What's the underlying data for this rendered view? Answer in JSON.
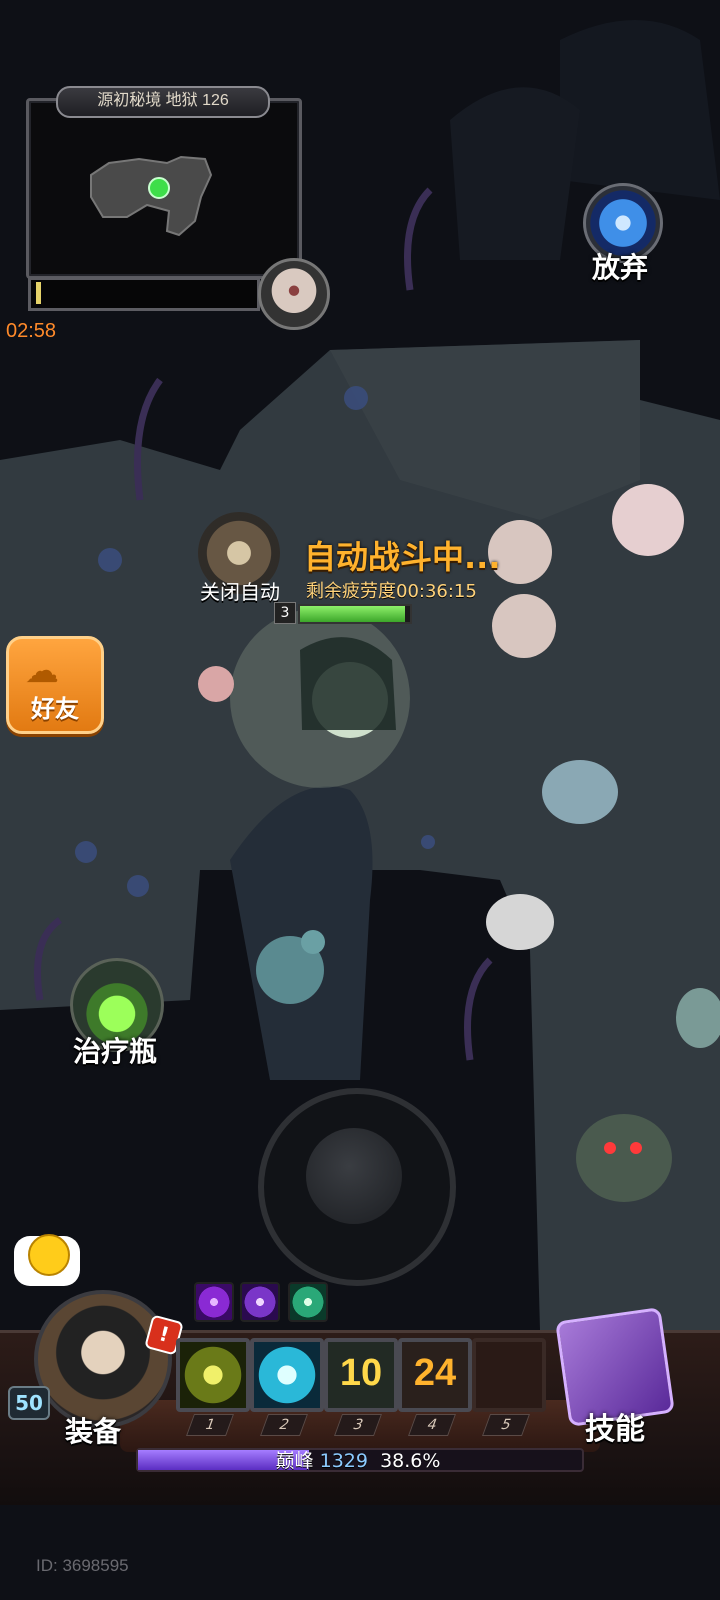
{
  "hud": {
    "dungeon_title": "源初秘境 地狱 126",
    "timer": "02:58",
    "abandon_label": "放弃",
    "auto_off_label": "关闭自动",
    "auto_status": "自动战斗中...",
    "fatigue": "剩余疲劳度00:36:15",
    "player_level": "3",
    "player_hp_fraction": 0.95,
    "dungeon_progress_fraction": 0.02
  },
  "left_panel": {
    "friends_label": "好友",
    "potion_label": "治疗瓶"
  },
  "bottom": {
    "hero_level": "50",
    "alert": "!",
    "equip_label": "装备",
    "skill_label": "技能",
    "slots": [
      {
        "num": "1",
        "text": "",
        "icon": "arrow-strike-icon"
      },
      {
        "num": "2",
        "text": "",
        "icon": "ice-slash-icon"
      },
      {
        "num": "3",
        "text": "10",
        "icon": "cooldown"
      },
      {
        "num": "4",
        "text": "24",
        "icon": "cooldown"
      },
      {
        "num": "5",
        "text": "",
        "icon": "empty"
      }
    ],
    "buffs": [
      "purple-aura-icon",
      "lightning-buff-icon",
      "vortex-buff-icon"
    ],
    "peak_label": "巅峰",
    "peak_value": "1329",
    "xp_percent": "38.6%",
    "xp_fraction": 0.386
  },
  "footer": {
    "player_id": "ID: 3698595"
  },
  "colors": {
    "orange_accent": "#ffb22d",
    "timer_orange": "#ff8a2a",
    "xp_purple": "#7a48e0",
    "hp_green": "#5fd045"
  }
}
